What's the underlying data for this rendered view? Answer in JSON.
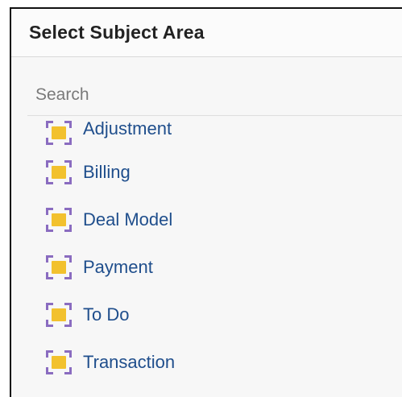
{
  "dialog": {
    "title": "Select Subject Area"
  },
  "search": {
    "placeholder": "Search",
    "value": ""
  },
  "subject_areas": [
    {
      "label": "Adjustment",
      "icon": "subject-area-icon"
    },
    {
      "label": "Billing",
      "icon": "subject-area-icon"
    },
    {
      "label": "Deal Model",
      "icon": "subject-area-icon"
    },
    {
      "label": "Payment",
      "icon": "subject-area-icon"
    },
    {
      "label": "To Do",
      "icon": "subject-area-icon"
    },
    {
      "label": "Transaction",
      "icon": "subject-area-icon"
    }
  ],
  "colors": {
    "icon_bracket": "#8a6cc0",
    "icon_core": "#f2c12e",
    "link_text": "#1f4e8c"
  }
}
